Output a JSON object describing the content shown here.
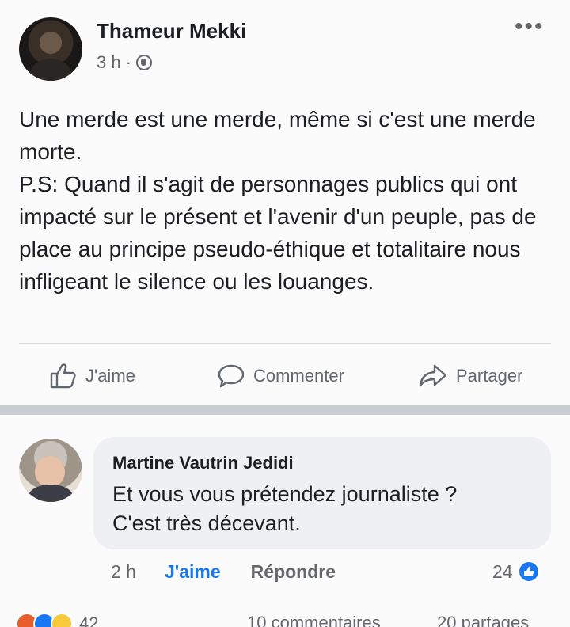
{
  "post": {
    "author": "Thameur Mekki",
    "time": "3 h",
    "separator": "·",
    "more_label": "•••",
    "text_lines": [
      "Une merde est une merde, même si c'est une merde morte.",
      "P.S: Quand il s'agit de personnages publics qui ont impacté sur le présent et l'avenir d'un peuple, pas de place au principe pseudo-éthique et totalitaire nous infligeant le silence ou les louanges."
    ],
    "actions": {
      "like": "J'aime",
      "comment": "Commenter",
      "share": "Partager"
    }
  },
  "comment": {
    "author": "Martine Vautrin Jedidi",
    "text_lines": [
      "Et vous vous prétendez journaliste ?",
      "C'est très décevant."
    ],
    "time": "2 h",
    "like": "J'aime",
    "reply": "Répondre",
    "reaction_count": "24"
  },
  "footer": {
    "reaction_count": "42",
    "comments": "10 commentaires",
    "shares": "20 partages"
  },
  "colors": {
    "accent": "#1877f2",
    "secondary_text": "#65676b"
  }
}
